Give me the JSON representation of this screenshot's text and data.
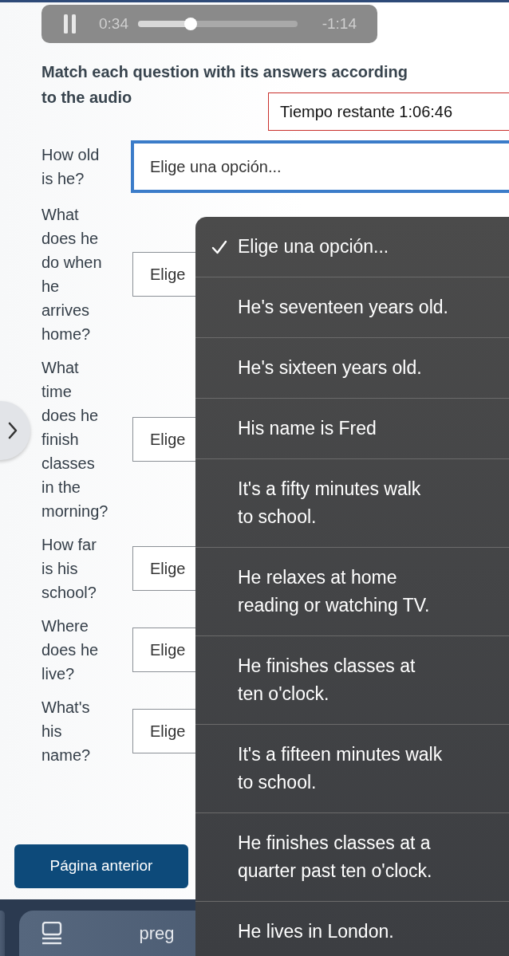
{
  "audio": {
    "playing": true,
    "elapsed": "0:34",
    "remaining": "-1:14",
    "level": 0.33
  },
  "instructions": "Match each question with its answers according to the audio",
  "timer": "Tiempo restante 1:06:46",
  "questions": [
    {
      "text": "How old is he?",
      "select": "Elige una opción...",
      "focused": true
    },
    {
      "text": "What does he do when he arrives home?",
      "select": "Elige",
      "focused": false
    },
    {
      "text": "What time does he finish classes in the morning?",
      "select": "Elige",
      "focused": false
    },
    {
      "text": "How far is his school?",
      "select": "Elige",
      "focused": false
    },
    {
      "text": "Where does he live?",
      "select": "Elige",
      "focused": false
    },
    {
      "text": "What's his name?",
      "select": "Elige",
      "focused": false
    }
  ],
  "dropdown": {
    "options": [
      {
        "label": "Elige una opción...",
        "selected": true
      },
      {
        "label": "He's seventeen years old.",
        "selected": false
      },
      {
        "label": "He's sixteen years old.",
        "selected": false
      },
      {
        "label": "His name is Fred",
        "selected": false
      },
      {
        "label": "It's a fifty minutes walk\nto school.",
        "selected": false
      },
      {
        "label": "He relaxes at home\nreading or watching TV.",
        "selected": false
      },
      {
        "label": "He finishes classes at\nten o'clock.",
        "selected": false
      },
      {
        "label": "It's a fifteen minutes walk\nto school.",
        "selected": false
      },
      {
        "label": "He finishes classes at a\nquarter past ten o'clock.",
        "selected": false
      },
      {
        "label": "He lives in London.",
        "selected": false
      }
    ]
  },
  "prev_button": "Página anterior",
  "bottom_bar": {
    "label": "preg"
  }
}
